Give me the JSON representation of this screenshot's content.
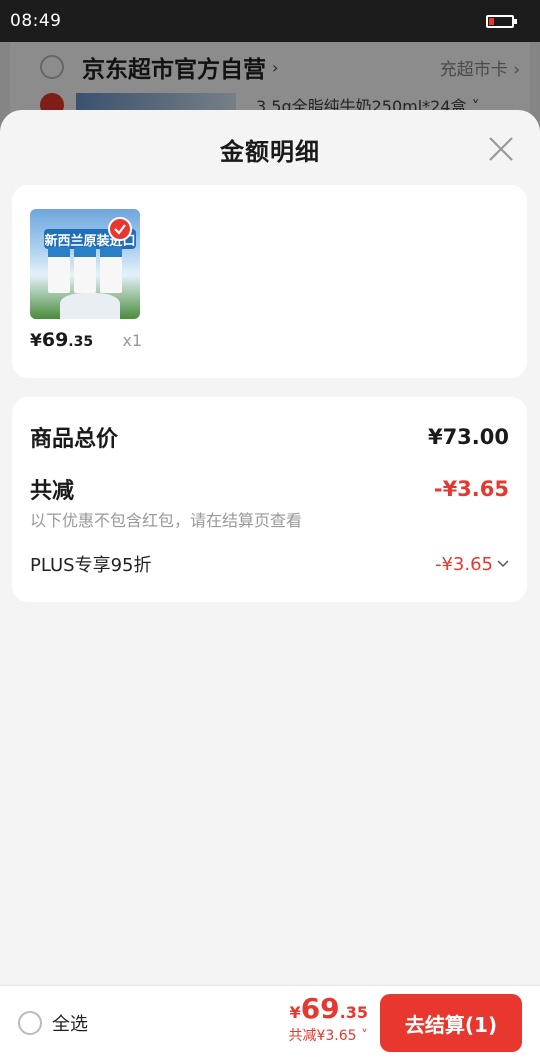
{
  "status_bar": {
    "time": "08:49"
  },
  "background": {
    "store_name": "京东超市官方自营",
    "store_chevron": "›",
    "charge_card": "充超市卡 ›",
    "product_name": "3.5g全脂纯牛奶250ml*24盒 ˅"
  },
  "sheet": {
    "title": "金额明细",
    "item": {
      "banner": "新西兰原装进口",
      "currency": "¥",
      "price_int": "69",
      "price_dec": ".35",
      "qty": "x1"
    },
    "details": {
      "total_label": "商品总价",
      "total_value": "¥73.00",
      "reduce_label": "共减",
      "reduce_value": "-¥3.65",
      "note": "以下优惠不包含红包，请在结算页查看",
      "plus_label": "PLUS专享95折",
      "plus_value": "-¥3.65"
    }
  },
  "bottom_bar": {
    "select_all": "全选",
    "currency": "¥",
    "total_int": "69",
    "total_dec": ".35",
    "total_reduce": "共减¥3.65 ˅",
    "checkout": "去结算(1)"
  },
  "colors": {
    "accent": "#e8372e"
  }
}
